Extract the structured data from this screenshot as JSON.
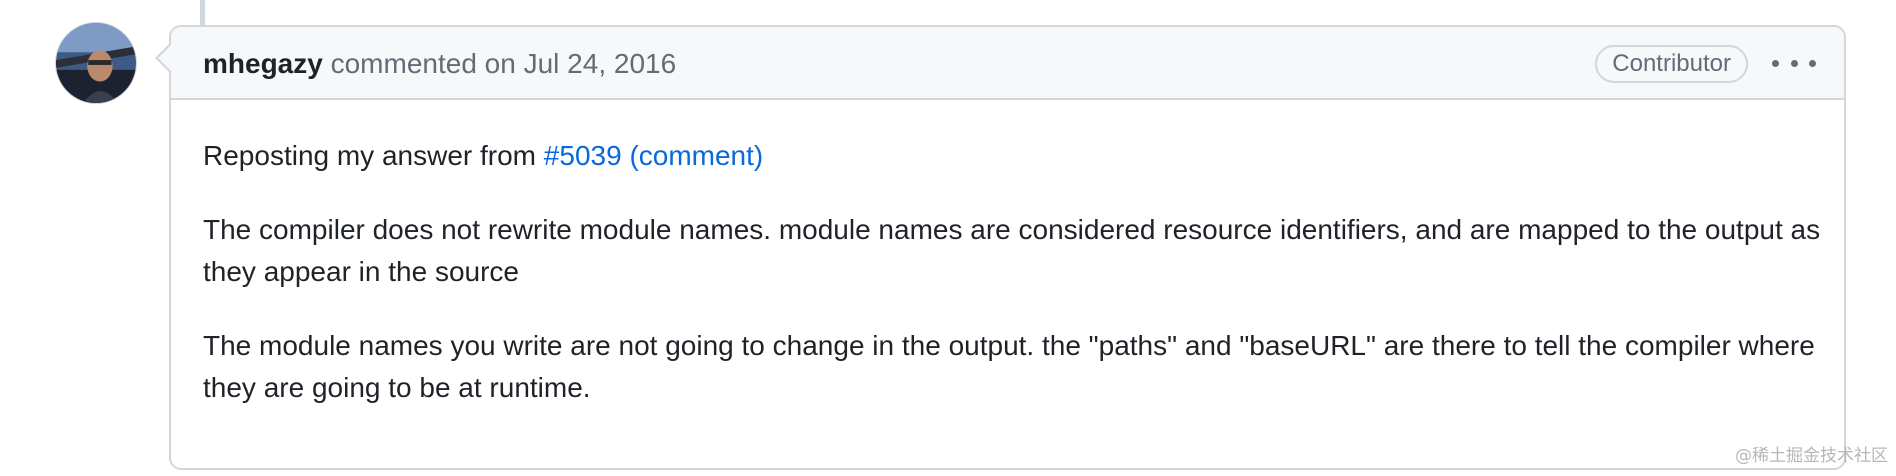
{
  "comment": {
    "author": "mhegazy",
    "action_text": "commented on",
    "date": "Jul 24, 2016",
    "role_badge": "Contributor",
    "more_icon": "kebab-horizontal-icon",
    "body": {
      "p1_prefix": "Reposting my answer from ",
      "p1_link": "#5039 (comment)",
      "p2": "The compiler does not rewrite module names. module names are considered resource identifiers, and are mapped to the output as they appear in the source",
      "p3": "The module names you write are not going to change in the output. the \"paths\" and \"baseURL\" are there to tell the compiler where they are going to be at runtime."
    }
  },
  "watermark": "@稀土掘金技术社区",
  "colors": {
    "link": "#0969da",
    "border": "#d0d7de",
    "header_bg": "#f6f8fa",
    "muted_text": "#636c76"
  }
}
